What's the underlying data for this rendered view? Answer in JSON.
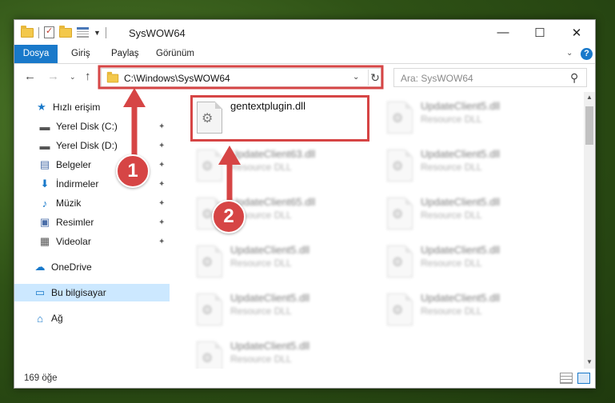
{
  "window": {
    "title": "SysWOW64",
    "controls": {
      "minimize": "—",
      "maximize": "☐",
      "close": "✕"
    }
  },
  "ribbon": {
    "tabs": [
      "Dosya",
      "Giriş",
      "Paylaş",
      "Görünüm"
    ]
  },
  "nav": {
    "back": "←",
    "forward": "→",
    "recent": "⌄",
    "up": "↑",
    "address": "C:\\Windows\\SysWOW64",
    "address_dropdown": "⌄",
    "refresh": "↻",
    "search_placeholder": "Ara: SysWOW64",
    "search_icon": "⚲"
  },
  "sidebar": {
    "items": [
      {
        "label": "Hızlı erişim",
        "icon": "quick-access-star-icon",
        "glyph": "★",
        "pinned": false
      },
      {
        "label": "Yerel Disk (C:)",
        "icon": "drive-icon",
        "glyph": "▬",
        "pinned": true
      },
      {
        "label": "Yerel Disk (D:)",
        "icon": "drive-icon",
        "glyph": "▬",
        "pinned": true
      },
      {
        "label": "Belgeler",
        "icon": "documents-icon",
        "glyph": "▤",
        "pinned": true
      },
      {
        "label": "İndirmeler",
        "icon": "downloads-arrow-icon",
        "glyph": "⬇",
        "pinned": true
      },
      {
        "label": "Müzik",
        "icon": "music-note-icon",
        "glyph": "♪",
        "pinned": true
      },
      {
        "label": "Resimler",
        "icon": "pictures-icon",
        "glyph": "▣",
        "pinned": true
      },
      {
        "label": "Videolar",
        "icon": "film-strip-icon",
        "glyph": "▦",
        "pinned": true
      },
      {
        "label": "OneDrive",
        "icon": "cloud-icon",
        "glyph": "☁",
        "pinned": false
      },
      {
        "label": "Bu bilgisayar",
        "icon": "computer-monitor-icon",
        "glyph": "▭",
        "pinned": false,
        "selected": true
      },
      {
        "label": "Ağ",
        "icon": "network-icon",
        "glyph": "⌂",
        "pinned": false
      }
    ],
    "pin_glyph": "📌"
  },
  "files": {
    "highlighted": {
      "name": "gentextplugin.dll",
      "type": ""
    },
    "blurred": [
      {
        "name": "UpdateClient5.dll",
        "type": "Resource DLL"
      },
      {
        "name": "UpdateClient63.dll",
        "type": "Resource DLL"
      },
      {
        "name": "UpdateClient5.dll",
        "type": "Resource DLL"
      },
      {
        "name": "UpdateClient65.dll",
        "type": "Resource DLL"
      },
      {
        "name": "UpdateClient5.dll",
        "type": "Resource DLL"
      },
      {
        "name": "UpdateClient5.dll",
        "type": "Resource DLL"
      },
      {
        "name": "UpdateClient5.dll",
        "type": "Resource DLL"
      },
      {
        "name": "UpdateClient5.dll",
        "type": "Resource DLL"
      },
      {
        "name": "UpdateClient5.dll",
        "type": "Resource DLL"
      },
      {
        "name": "UpdateClient5.dll",
        "type": "Resource DLL"
      }
    ]
  },
  "status": {
    "count": "169 öğe"
  },
  "annotations": {
    "badge1": "1",
    "badge2": "2",
    "accent_color": "#d64545"
  },
  "colors": {
    "file_tab": "#1979ca",
    "selected_nav": "#cce8ff"
  }
}
